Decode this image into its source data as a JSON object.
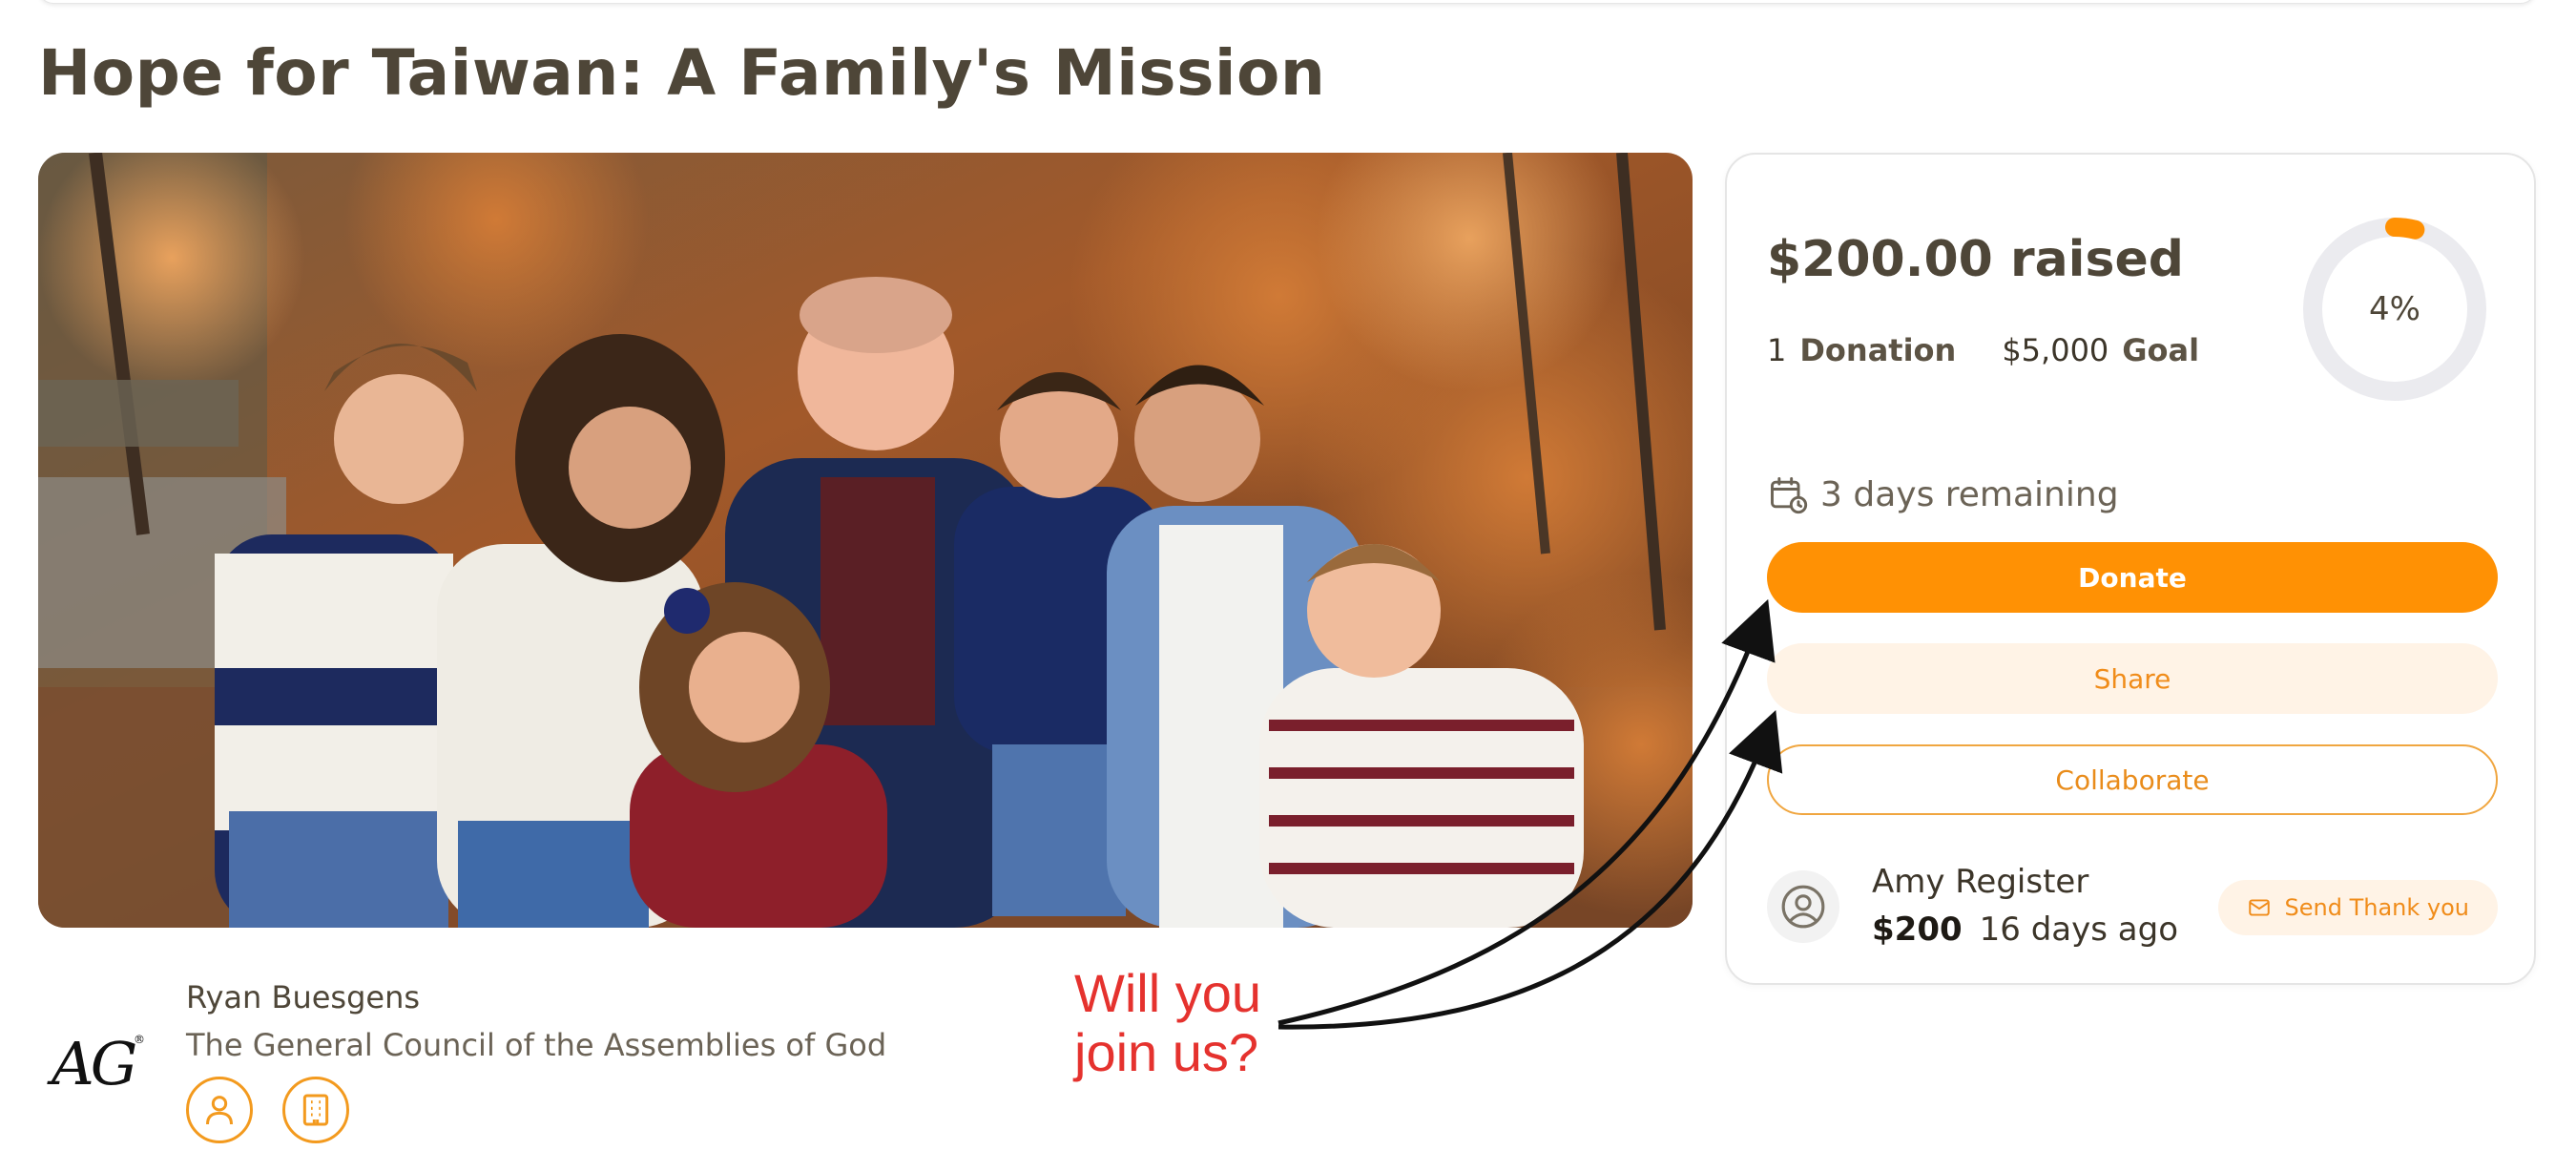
{
  "campaign": {
    "title": "Hope for Taiwan: A Family's Mission",
    "hero_image_alt": "Family of seven posed in front of autumn trees"
  },
  "summary": {
    "raised": "$200.00 raised",
    "donation_count": "1",
    "donation_label": "Donation",
    "goal_amount": "$5,000",
    "goal_label": "Goal",
    "progress_text": "4%",
    "progress_fraction": 0.04,
    "remaining": "3 days remaining"
  },
  "buttons": {
    "donate": "Donate",
    "share": "Share",
    "collaborate": "Collaborate",
    "send_thank_you": "Send Thank you"
  },
  "recent_donation": {
    "name": "Amy Register",
    "amount": "$200",
    "time": "16 days ago"
  },
  "organizer": {
    "person": "Ryan Buesgens",
    "organization": "The General Council of the Assemblies of God",
    "logo_text": "AG",
    "logo_mark": "®"
  },
  "annotation": {
    "line1": "Will you",
    "line2": "join us?"
  },
  "icons": [
    "calendar-clock-icon",
    "user-circle-icon",
    "mail-icon",
    "person-icon",
    "building-icon"
  ],
  "colors": {
    "accent": "#ff9104",
    "accent_soft": "#fff3e6",
    "title_text": "#4e4638",
    "annotation_red": "#e5322e",
    "ring_track": "#ebebef"
  }
}
